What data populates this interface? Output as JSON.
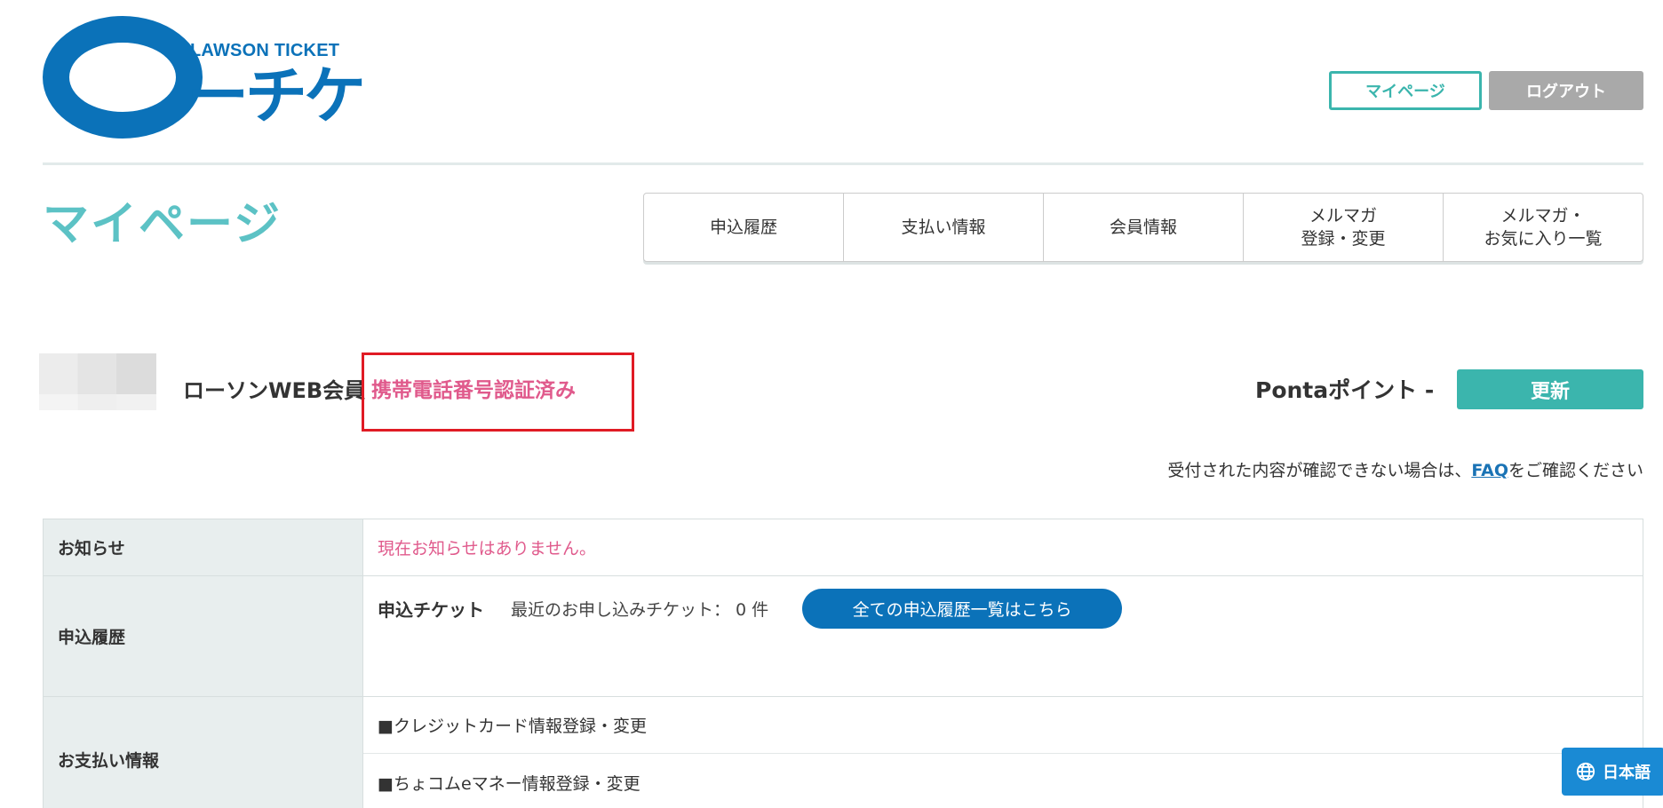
{
  "header": {
    "logo_small": "LAWSON TICKET",
    "logo_big": "ーチケ",
    "mypage_button": "マイページ",
    "logout_button": "ログアウト"
  },
  "page_title": "マイページ",
  "tabs": [
    {
      "label": "申込履歴"
    },
    {
      "label": "支払い情報"
    },
    {
      "label": "会員情報"
    },
    {
      "label": "メルマガ\n登録・変更"
    },
    {
      "label": "メルマガ・\nお気に入り一覧"
    }
  ],
  "member": {
    "type_label": "ローソンWEB会員",
    "verified_label": "携帯電話番号認証済み",
    "ponta_label": "Pontaポイント -",
    "update_button": "更新"
  },
  "faq": {
    "prefix": "受付された内容が確認できない場合は、",
    "link": "FAQ",
    "suffix": "をご確認ください"
  },
  "info_table": {
    "notice": {
      "head": "お知らせ",
      "text": "現在お知らせはありません。"
    },
    "apply": {
      "head": "申込履歴",
      "title": "申込チケット",
      "recent": "最近のお申し込みチケット： 0 件",
      "button": "全ての申込履歴一覧はこちら"
    },
    "payment": {
      "head": "お支払い情報",
      "items": [
        "■クレジットカード情報登録・変更",
        "■ちょコムeマネー情報登録・変更"
      ]
    }
  },
  "language_button": "日本語",
  "colors": {
    "brand_blue": "#0b72b9",
    "teal": "#3bb5ad",
    "pink": "#e05a8c",
    "highlight_red": "#e01b24"
  }
}
